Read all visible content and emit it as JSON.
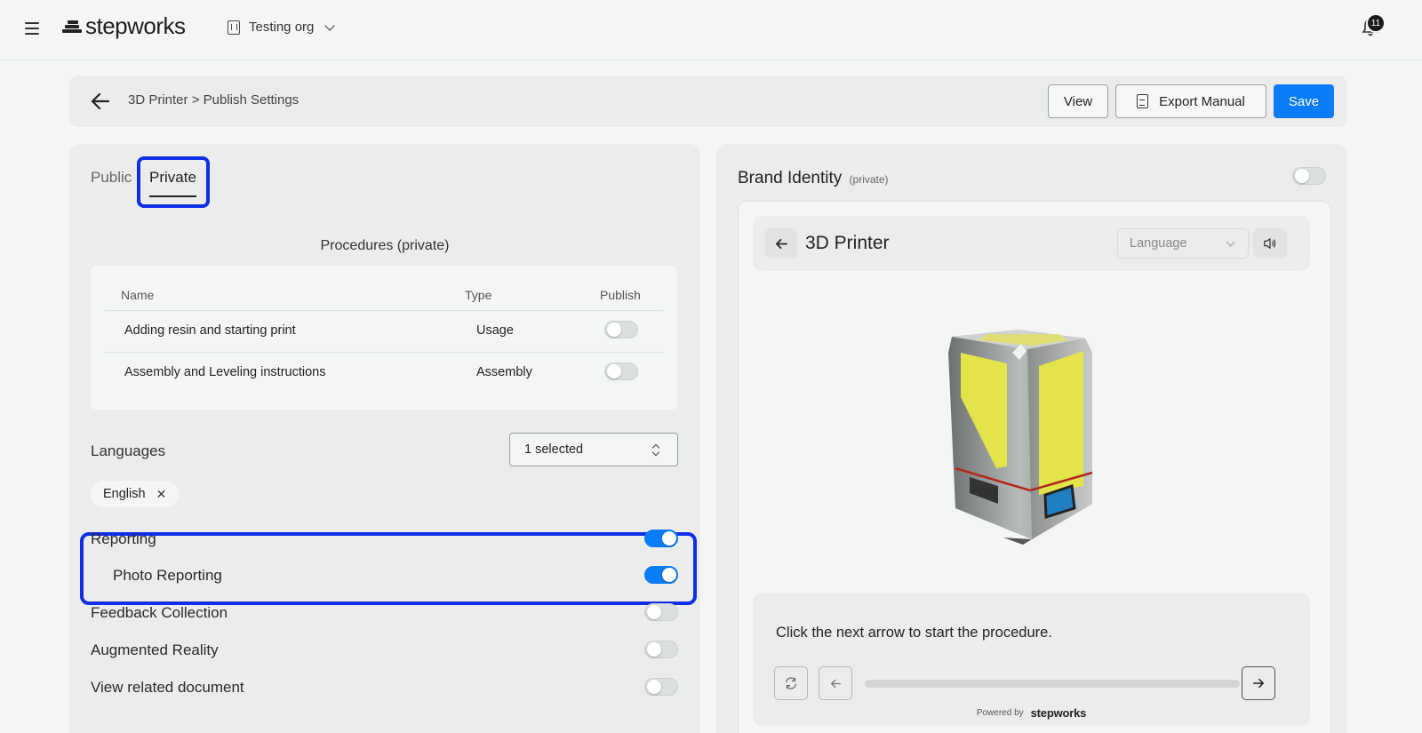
{
  "app": {
    "brand": "stepworks",
    "org_name": "Testing org",
    "notification_count": "11"
  },
  "header": {
    "breadcrumb": "3D Printer > Publish Settings",
    "view_label": "View",
    "export_label": "Export Manual",
    "save_label": "Save"
  },
  "tabs": {
    "public": "Public",
    "private": "Private",
    "active": "Private"
  },
  "procedures": {
    "title": "Procedures (private)",
    "columns": [
      "Name",
      "Type",
      "Publish"
    ],
    "rows": [
      {
        "name": "Adding resin and starting print",
        "type": "Usage",
        "publish": false
      },
      {
        "name": "Assembly and Leveling instructions",
        "type": "Assembly",
        "publish": false
      }
    ]
  },
  "languages": {
    "label": "Languages",
    "select_value": "1 selected",
    "chips": [
      "English"
    ]
  },
  "features": [
    {
      "label": "Reporting",
      "enabled": true
    },
    {
      "label": "Photo Reporting",
      "enabled": true
    },
    {
      "label": "Feedback Collection",
      "enabled": false
    },
    {
      "label": "Augmented Reality",
      "enabled": false
    },
    {
      "label": "View related document",
      "enabled": false
    }
  ],
  "brand_identity": {
    "title": "Brand Identity",
    "subtitle": "(private)",
    "enabled": false
  },
  "preview": {
    "title": "3D Printer",
    "language_placeholder": "Language",
    "instruction": "Click the next arrow to start the procedure.",
    "powered_by": "Powered by",
    "powered_brand": "stepworks",
    "progress": 0
  },
  "colors": {
    "accent": "#0a7cf5",
    "highlight": "#0f2ee8",
    "background": "#f4f6f6",
    "panel": "#ececec"
  }
}
